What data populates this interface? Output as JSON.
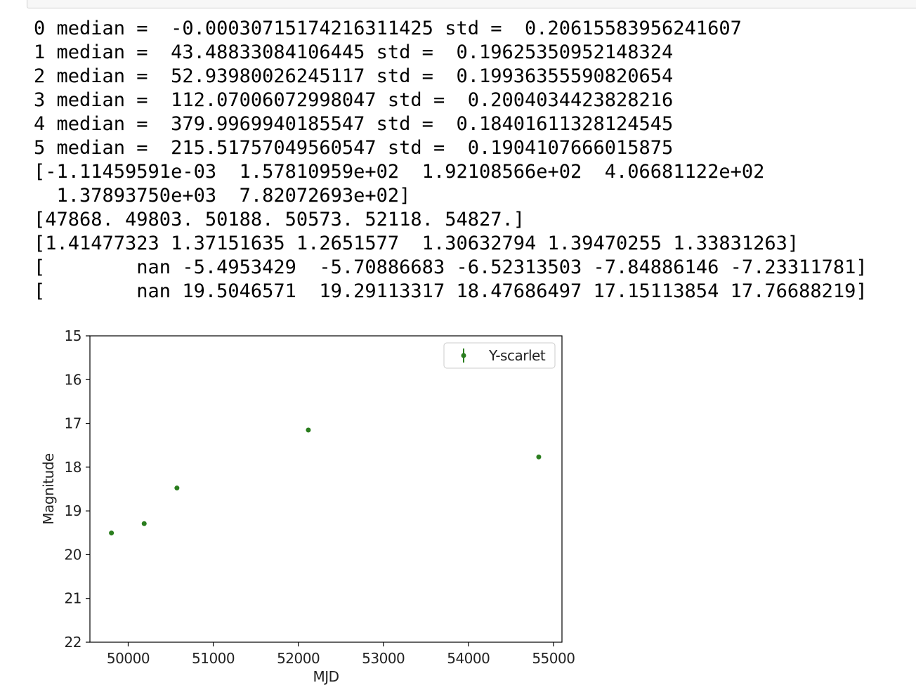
{
  "output_lines": [
    "0 median =  -0.00030715174216311425 std =  0.20615583956241607",
    "1 median =  43.48833084106445 std =  0.19625350952148324",
    "2 median =  52.93980026245117 std =  0.19936355590820654",
    "3 median =  112.07006072998047 std =  0.2004034423828216",
    "4 median =  379.9969940185547 std =  0.18401611328124545",
    "5 median =  215.51757049560547 std =  0.1904107666015875",
    "[-1.11459591e-03  1.57810959e+02  1.92108566e+02  4.06681122e+02",
    "  1.37893750e+03  7.82072693e+02]",
    "[47868. 49803. 50188. 50573. 52118. 54827.]",
    "[1.41477323 1.37151635 1.2651577  1.30632794 1.39470255 1.33831263]",
    "[        nan -5.4953429  -5.70886683 -6.52313503 -7.84886146 -7.23311781]",
    "[        nan 19.5046571  19.29113317 18.47686497 17.15113854 17.76688219]"
  ],
  "chart_data": {
    "type": "scatter",
    "title": "",
    "xlabel": "MJD",
    "ylabel": "Magnitude",
    "xlim": [
      49550,
      55100
    ],
    "ylim": [
      22,
      15
    ],
    "y_inverted": true,
    "xticks": [
      50000,
      51000,
      52000,
      53000,
      54000,
      55000
    ],
    "xtick_labels": [
      "50000",
      "51000",
      "52000",
      "53000",
      "54000",
      "55000"
    ],
    "yticks": [
      15,
      16,
      17,
      18,
      19,
      20,
      21,
      22
    ],
    "ytick_labels": [
      "15",
      "16",
      "17",
      "18",
      "19",
      "20",
      "21",
      "22"
    ],
    "grid": false,
    "legend_position": "upper right",
    "series": [
      {
        "name": "Y-scarlet",
        "color": "#2a7d1e",
        "marker": "dot with errorbars",
        "x": [
          49803,
          50188,
          50573,
          52118,
          54827
        ],
        "y": [
          19.5046571,
          19.29113317,
          18.47686497,
          17.15113854,
          17.76688219
        ]
      }
    ]
  }
}
